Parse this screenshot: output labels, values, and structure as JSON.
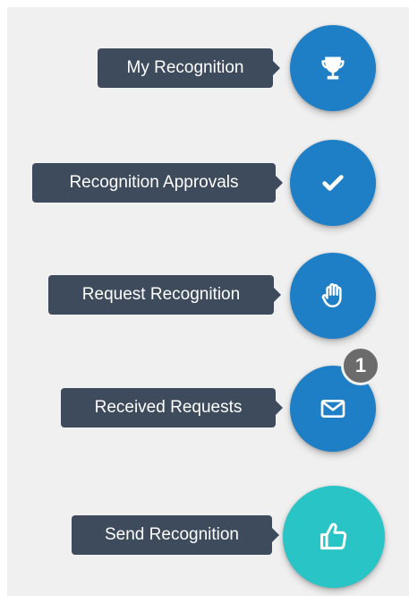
{
  "theme": {
    "primary": "#1f7fc6",
    "accent": "#29c4c6",
    "tooltip_bg": "#3d4b5c",
    "badge_bg": "#6b6b6b"
  },
  "actions": [
    {
      "label": "My Recognition",
      "icon": "trophy-icon"
    },
    {
      "label": "Recognition Approvals",
      "icon": "check-icon"
    },
    {
      "label": "Request Recognition",
      "icon": "hand-icon"
    },
    {
      "label": "Received Requests",
      "icon": "envelope-icon",
      "badge": "1"
    },
    {
      "label": "Send Recognition",
      "icon": "thumbs-up-icon"
    }
  ]
}
